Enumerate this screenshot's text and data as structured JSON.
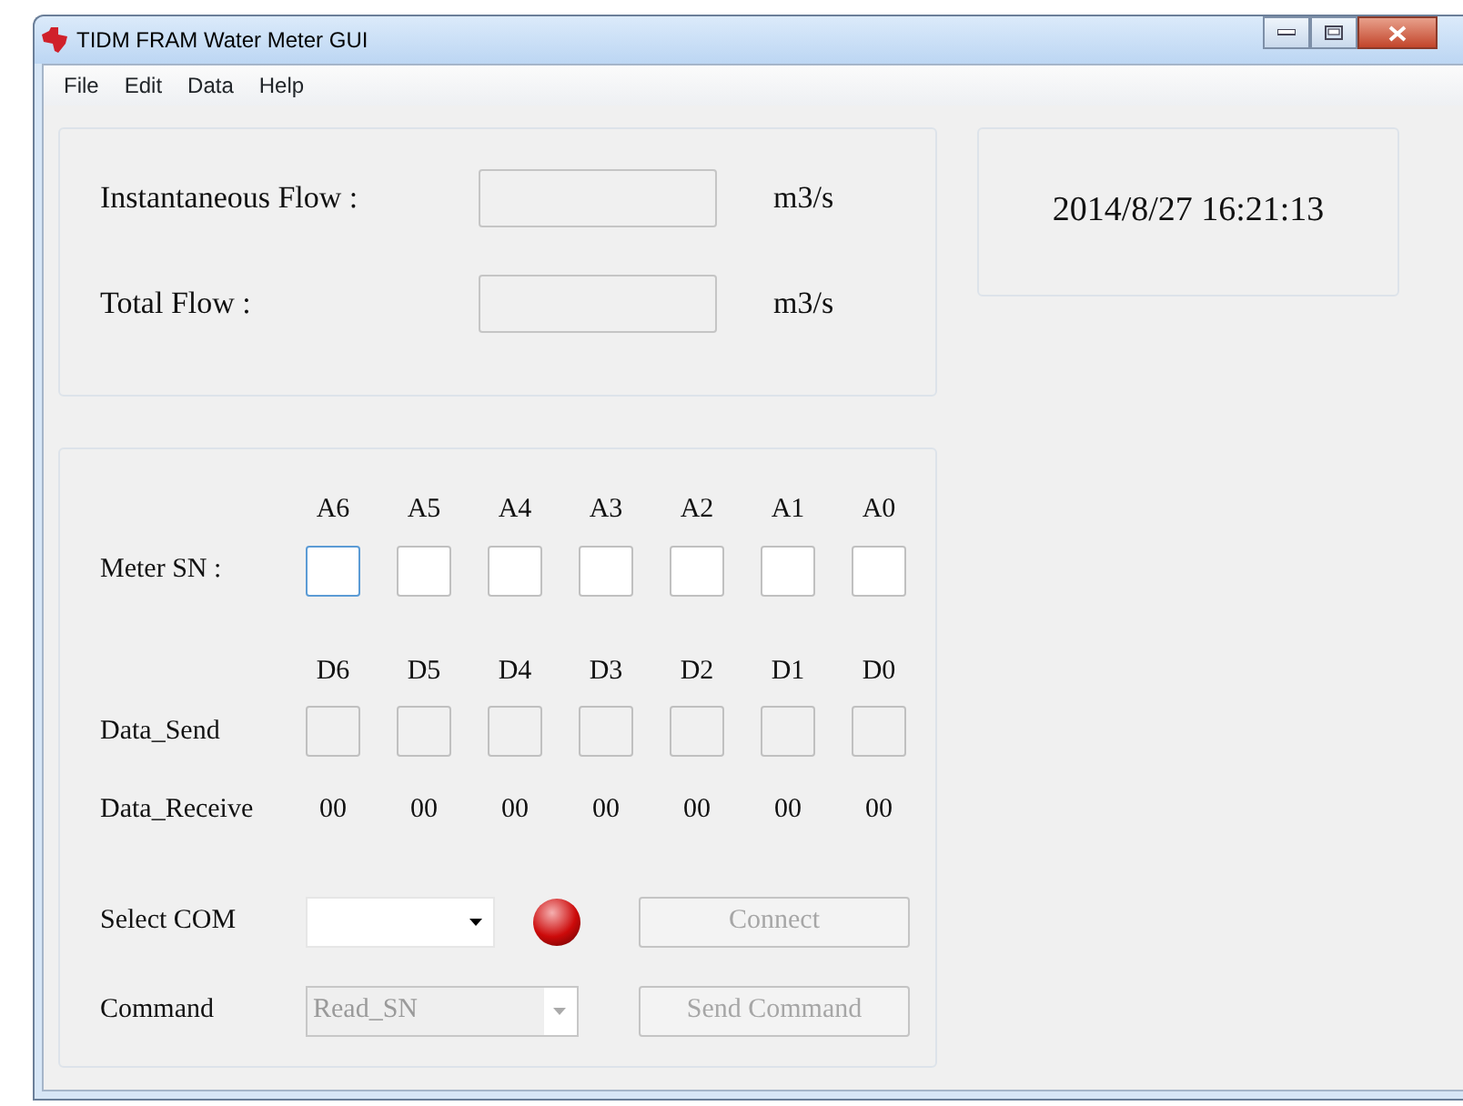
{
  "window": {
    "title": "TIDM FRAM Water Meter GUI"
  },
  "menu": [
    "File",
    "Edit",
    "Data",
    "Help"
  ],
  "flow": [
    {
      "label": "Instantaneous Flow :",
      "unit": "m3/s"
    },
    {
      "label": "Total Flow :",
      "unit": "m3/s"
    }
  ],
  "datetime": "2014/8/27 16:21:13",
  "meter_sn": {
    "label": "Meter SN :",
    "columns": [
      "A6",
      "A5",
      "A4",
      "A3",
      "A2",
      "A1",
      "A0"
    ],
    "fields": [
      {
        "focused": true
      },
      {
        "focused": false
      },
      {
        "focused": false
      },
      {
        "focused": false
      },
      {
        "focused": false
      },
      {
        "focused": false
      },
      {
        "focused": false
      }
    ]
  },
  "data_send": {
    "label": "Data_Send",
    "columns": [
      "D6",
      "D5",
      "D4",
      "D3",
      "D2",
      "D1",
      "D0"
    ],
    "fields": [
      {
        "disabled": true
      },
      {
        "disabled": true
      },
      {
        "disabled": true
      },
      {
        "disabled": true
      },
      {
        "disabled": true
      },
      {
        "disabled": true
      },
      {
        "disabled": true
      }
    ]
  },
  "data_receive": {
    "label": "Data_Receive",
    "values": [
      "00",
      "00",
      "00",
      "00",
      "00",
      "00",
      "00"
    ]
  },
  "select_com": {
    "label": "Select COM",
    "disabled": false,
    "connected": false,
    "button": {
      "label": "Connect",
      "disabled": true
    }
  },
  "command": {
    "label": "Command",
    "value": "Read_SN",
    "disabled": true,
    "button": {
      "label": "Send Command",
      "disabled": true
    }
  }
}
